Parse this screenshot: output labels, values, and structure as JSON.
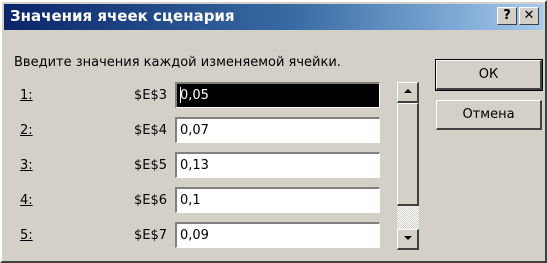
{
  "window": {
    "title": "Значения ячеек сценария",
    "help_label": "?",
    "close_label": "✕"
  },
  "instruction": "Введите значения каждой изменяемой ячейки.",
  "rows": [
    {
      "num": "1:",
      "ref": "$E$3",
      "value": "0,05"
    },
    {
      "num": "2:",
      "ref": "$E$4",
      "value": "0,07"
    },
    {
      "num": "3:",
      "ref": "$E$5",
      "value": "0,13"
    },
    {
      "num": "4:",
      "ref": "$E$6",
      "value": "0,1"
    },
    {
      "num": "5:",
      "ref": "$E$7",
      "value": "0,09"
    }
  ],
  "buttons": {
    "ok": "ОК",
    "cancel": "Отмена"
  },
  "icons": {
    "scroll_up": "arrow-up-icon",
    "scroll_down": "arrow-down-icon"
  },
  "colors": {
    "title_start": "#0a246a",
    "title_end": "#a6caf0",
    "face": "#d4d0c8",
    "selection": "#000000"
  }
}
